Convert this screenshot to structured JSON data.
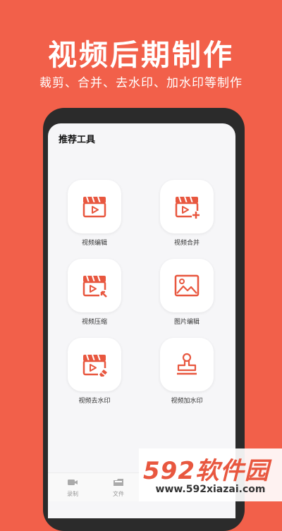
{
  "header": {
    "title": "视频后期制作",
    "subtitle": "裁剪、合并、去水印、加水印等制作"
  },
  "screen": {
    "title": "推荐工具",
    "tools": [
      {
        "label": "视频编辑",
        "icon": "video-clapper-icon"
      },
      {
        "label": "视频合并",
        "icon": "video-merge-icon"
      },
      {
        "label": "视频压缩",
        "icon": "video-compress-icon"
      },
      {
        "label": "图片编辑",
        "icon": "image-icon"
      },
      {
        "label": "视频去水印",
        "icon": "video-eraser-icon"
      },
      {
        "label": "视频加水印",
        "icon": "stamp-icon"
      }
    ],
    "tabs": [
      {
        "label": "录制",
        "icon": "camera-icon"
      },
      {
        "label": "文件",
        "icon": "folder-icon"
      }
    ]
  },
  "watermark": {
    "logo": "592软件园",
    "url": "www.592xiazai.com"
  },
  "colors": {
    "accent": "#f2604a",
    "icon": "#e8573f"
  }
}
